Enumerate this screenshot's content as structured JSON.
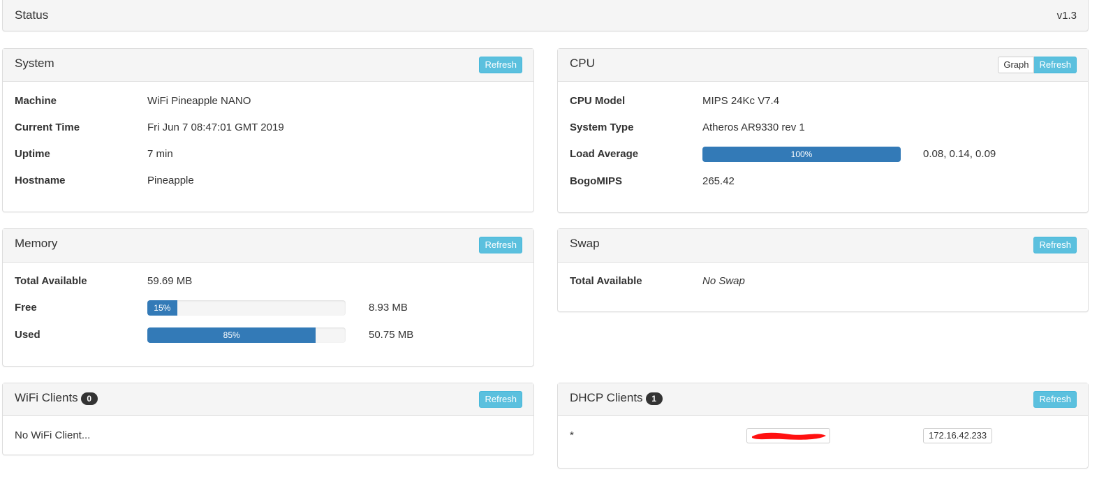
{
  "header": {
    "title": "Status",
    "version": "v1.3"
  },
  "system": {
    "title": "System",
    "refresh_label": "Refresh",
    "rows": [
      {
        "label": "Machine",
        "value": "WiFi Pineapple NANO"
      },
      {
        "label": "Current Time",
        "value": "Fri Jun 7 08:47:01 GMT 2019"
      },
      {
        "label": "Uptime",
        "value": "7 min"
      },
      {
        "label": "Hostname",
        "value": "Pineapple"
      }
    ]
  },
  "cpu": {
    "title": "CPU",
    "graph_label": "Graph",
    "refresh_label": "Refresh",
    "model_label": "CPU Model",
    "model_value": "MIPS 24Kc V7.4",
    "type_label": "System Type",
    "type_value": "Atheros AR9330 rev 1",
    "load_label": "Load Average",
    "load_percent": 100,
    "load_percent_text": "100%",
    "load_values": "0.08, 0.14, 0.09",
    "bogomips_label": "BogoMIPS",
    "bogomips_value": "265.42"
  },
  "memory": {
    "title": "Memory",
    "refresh_label": "Refresh",
    "total_label": "Total Available",
    "total_value": "59.69 MB",
    "free_label": "Free",
    "free_percent": 15,
    "free_percent_text": "15%",
    "free_value": "8.93 MB",
    "used_label": "Used",
    "used_percent": 85,
    "used_percent_text": "85%",
    "used_value": "50.75 MB"
  },
  "swap": {
    "title": "Swap",
    "refresh_label": "Refresh",
    "total_label": "Total Available",
    "total_value": "No Swap"
  },
  "wifi_clients": {
    "title": "WiFi Clients",
    "count": "0",
    "refresh_label": "Refresh",
    "empty_text": "No WiFi Client..."
  },
  "dhcp_clients": {
    "title": "DHCP Clients",
    "count": "1",
    "refresh_label": "Refresh",
    "clients": [
      {
        "hostname": "*",
        "ip": "172.16.42.233"
      }
    ]
  },
  "colors": {
    "accent": "#5bc0de",
    "progress": "#337ab7",
    "redaction": "#ff0000"
  }
}
